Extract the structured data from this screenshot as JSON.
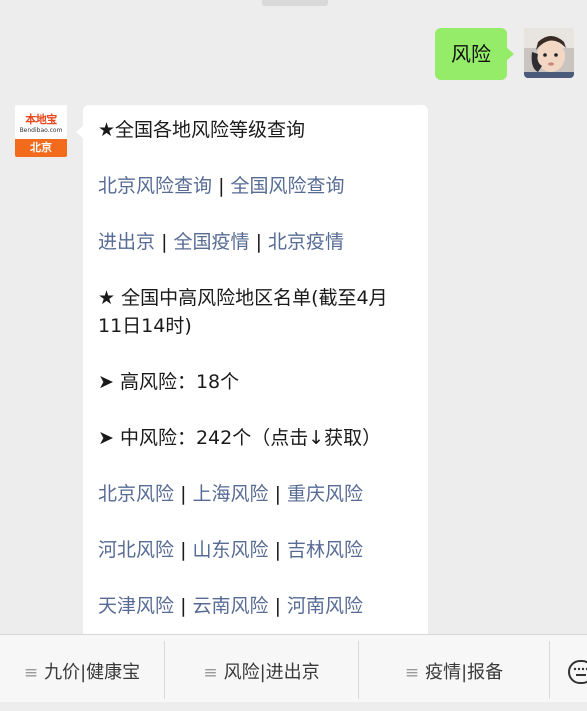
{
  "chat": {
    "user_message": "风险",
    "bot_avatar": {
      "logo_text": "本地宝",
      "logo_sub": "Bendibao.com",
      "city": "北京"
    },
    "reply": {
      "title": "★全国各地风险等级查询",
      "row1": [
        "北京风险查询",
        "全国风险查询"
      ],
      "row2": [
        "进出京",
        "全国疫情",
        "北京疫情"
      ],
      "list_title_1": "★ 全国中高风险地区名单(截至4月",
      "list_title_2": "11日14时)",
      "high_risk": "➤ 高风险：18个",
      "mid_risk": "➤ 中风险：242个（点击↓获取）",
      "row3": [
        "北京风险",
        "上海风险",
        "重庆风险"
      ],
      "row4": [
        "河北风险",
        "山东风险",
        "吉林风险"
      ],
      "row5": [
        "天津风险",
        "云南风险",
        "河南风险"
      ]
    }
  },
  "menu": {
    "items": [
      "九价|健康宝",
      "风险|进出京",
      "疫情|报备"
    ],
    "hamburger": "≡",
    "keyboard_icon": "keyboard-icon"
  },
  "colors": {
    "link": "#576b95",
    "user_bubble": "#95ec69",
    "background": "#ededed"
  },
  "separator": "|"
}
